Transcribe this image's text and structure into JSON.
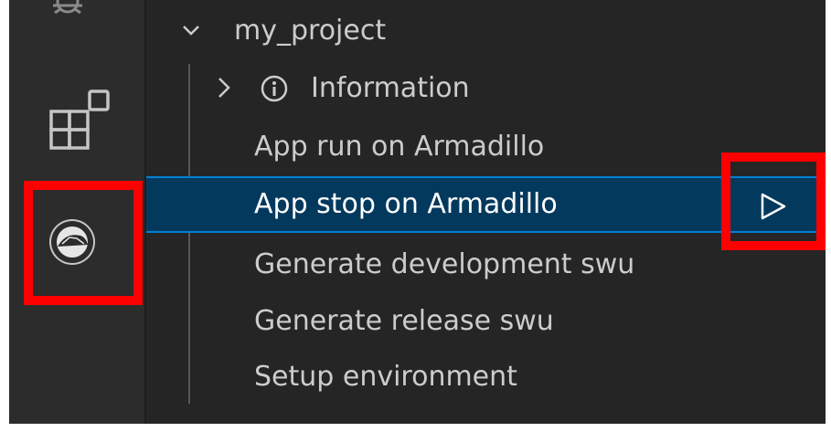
{
  "activity_bar": {
    "icons": [
      "debug-icon",
      "extensions-icon",
      "armadillo-icon"
    ]
  },
  "tree": {
    "project": {
      "label": "my_project",
      "expanded": true
    },
    "items": [
      {
        "label": "Information",
        "icon": "info-icon",
        "collapsible": true
      },
      {
        "label": "App run on Armadillo"
      },
      {
        "label": "App stop on Armadillo",
        "selected": true,
        "action_icon": "play-icon"
      },
      {
        "label": "Generate development swu"
      },
      {
        "label": "Generate release swu"
      },
      {
        "label": "Setup environment"
      }
    ]
  },
  "colors": {
    "background": "#252526",
    "activity_bar": "#2c2c2c",
    "selection": "#04395e",
    "selection_border": "#007fd4",
    "highlight": "#ff0000",
    "text": "#cccccc"
  }
}
